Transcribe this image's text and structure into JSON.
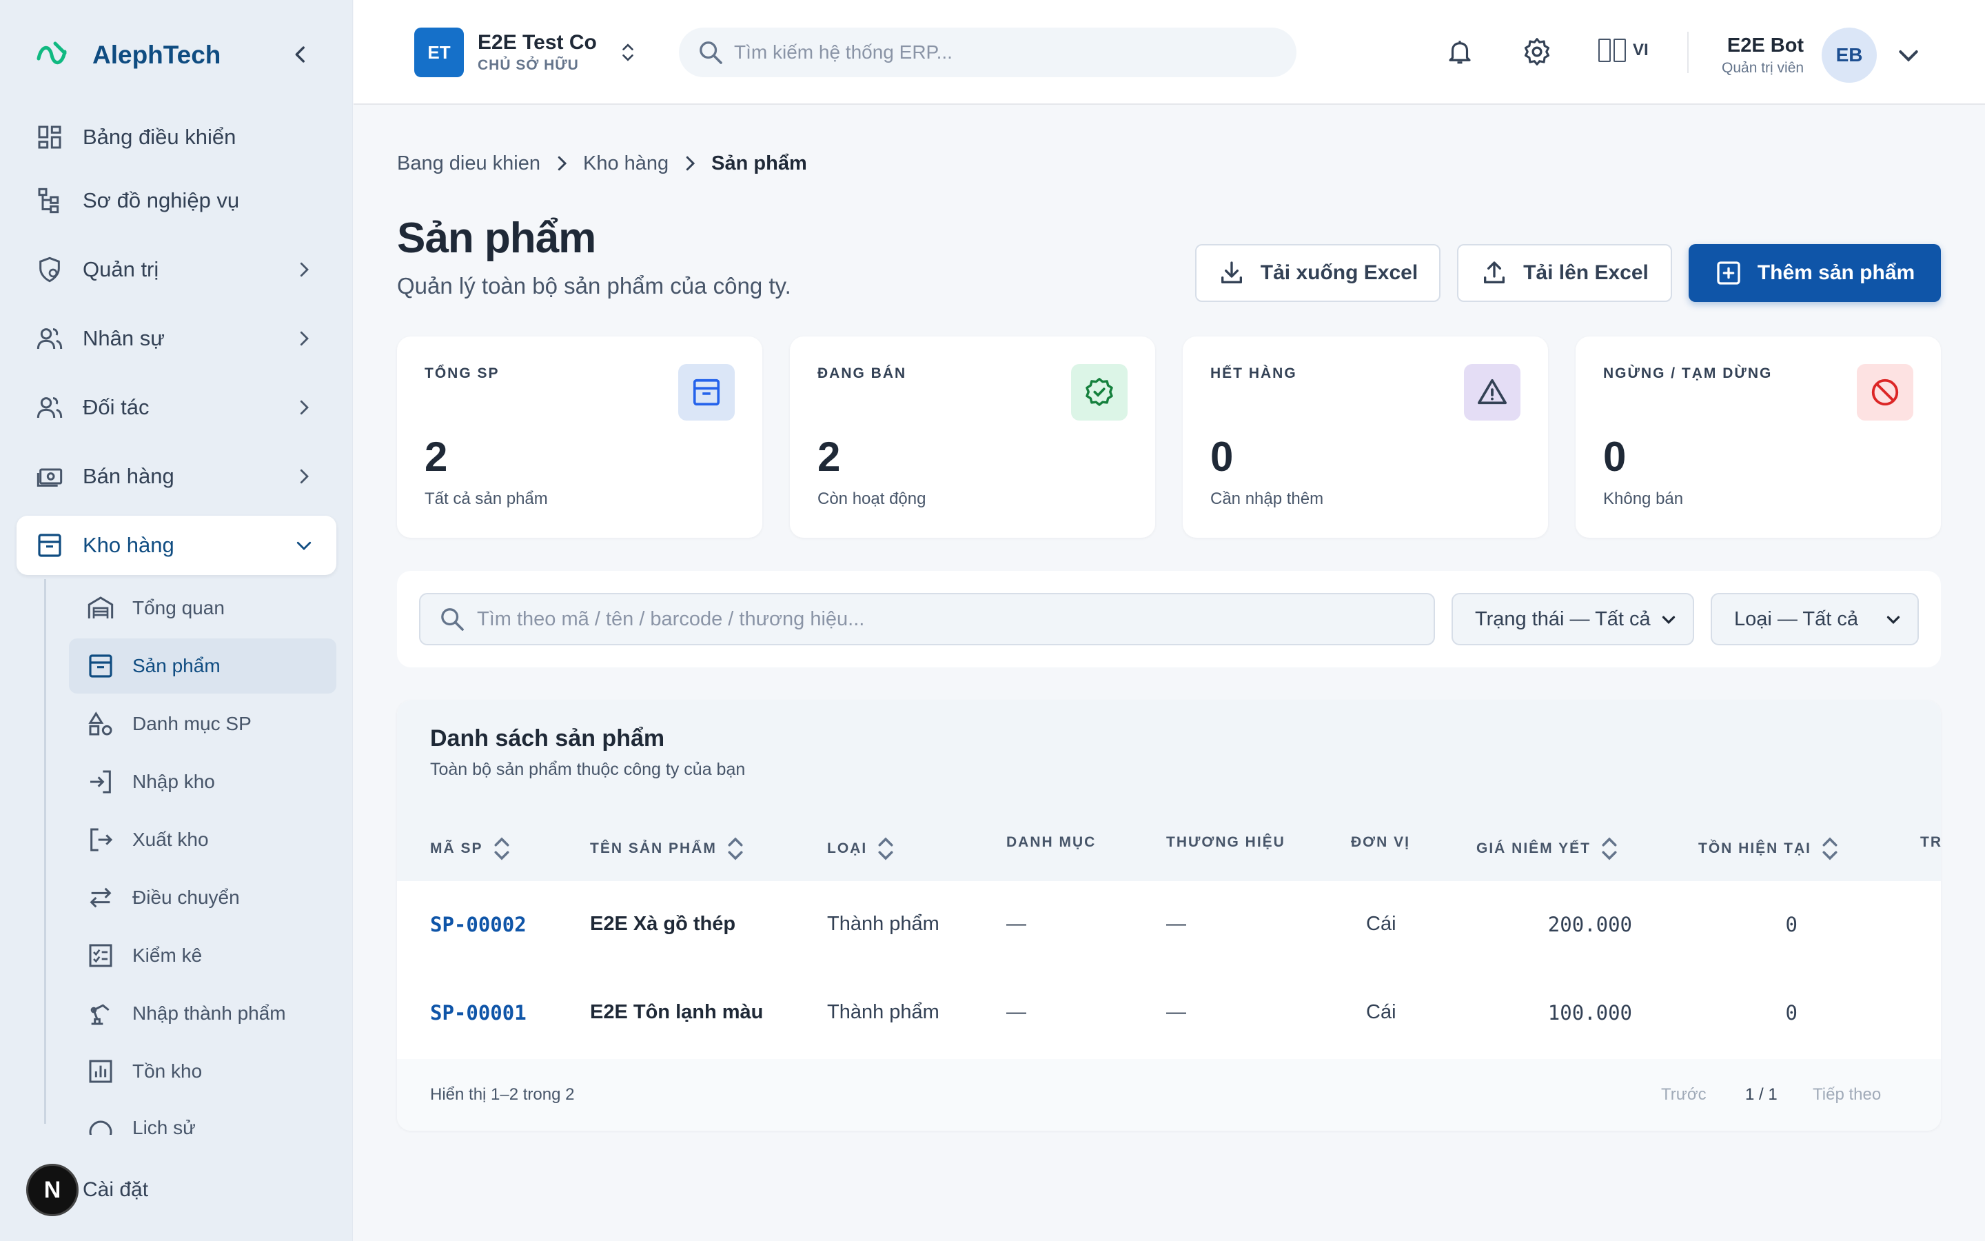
{
  "sidebar": {
    "brand": "AlephTech",
    "items": [
      {
        "label": "Bảng điều khiển",
        "icon": "dashboard-icon"
      },
      {
        "label": "Sơ đồ nghiệp vụ",
        "icon": "sitemap-icon"
      },
      {
        "label": "Quản trị",
        "icon": "admin-icon"
      },
      {
        "label": "Nhân sự",
        "icon": "users-icon"
      },
      {
        "label": "Đối tác",
        "icon": "partners-icon"
      },
      {
        "label": "Bán hàng",
        "icon": "cash-icon"
      },
      {
        "label": "Kho hàng",
        "icon": "archive-icon"
      }
    ],
    "sub_items": [
      {
        "label": "Tổng quan"
      },
      {
        "label": "Sản phẩm"
      },
      {
        "label": "Danh mục SP"
      },
      {
        "label": "Nhập kho"
      },
      {
        "label": "Xuất kho"
      },
      {
        "label": "Điều chuyển"
      },
      {
        "label": "Kiểm kê"
      },
      {
        "label": "Nhập thành phẩm"
      },
      {
        "label": "Tồn kho"
      },
      {
        "label": "Lịch sử"
      }
    ],
    "settings_badge": "N",
    "settings_label": "Cài đặt"
  },
  "topbar": {
    "company_avatar": "ET",
    "company_name": "E2E Test Co",
    "company_role": "CHỦ SỞ HỮU",
    "search_placeholder": "Tìm kiếm hệ thống ERP...",
    "language": "VI",
    "user_name": "E2E Bot",
    "user_role": "Quản trị viên",
    "user_initials": "EB"
  },
  "breadcrumb": [
    "Bang dieu khien",
    "Kho hàng",
    "Sản phẩm"
  ],
  "page": {
    "title": "Sản phẩm",
    "subtitle": "Quản lý toàn bộ sản phẩm của công ty."
  },
  "actions": {
    "download": "Tải xuống Excel",
    "upload": "Tải lên Excel",
    "add": "Thêm sản phẩm"
  },
  "stats": [
    {
      "label": "TỔNG SP",
      "value": "2",
      "note": "Tất cả sản phẩm",
      "icon": "archive-icon",
      "bg": "#dbe6f7",
      "color": "#2563eb"
    },
    {
      "label": "ĐANG BÁN",
      "value": "2",
      "note": "Còn hoạt động",
      "icon": "badge-check-icon",
      "bg": "#dcf5e7",
      "color": "#15803d"
    },
    {
      "label": "HẾT HÀNG",
      "value": "0",
      "note": "Cần nhập thêm",
      "icon": "warning-icon",
      "bg": "#e4ddf5",
      "color": "#334155"
    },
    {
      "label": "NGỪNG / TẠM DỪNG",
      "value": "0",
      "note": "Không bán",
      "icon": "ban-icon",
      "bg": "#fde2e2",
      "color": "#dc2626"
    }
  ],
  "filters": {
    "search_placeholder": "Tìm theo mã / tên / barcode / thương hiệu...",
    "status": "Trạng thái — Tất cả",
    "type": "Loại — Tất cả"
  },
  "table": {
    "title": "Danh sách sản phẩm",
    "subtitle": "Toàn bộ sản phẩm thuộc công ty của bạn",
    "columns": [
      "MÃ SP",
      "TÊN SẢN PHẨM",
      "LOẠI",
      "DANH MỤC",
      "THƯƠNG HIỆU",
      "ĐƠN VỊ",
      "GIÁ NIÊM YẾT",
      "TỒN HIỆN TẠI",
      "TR"
    ],
    "rows": [
      {
        "code": "SP-00002",
        "name": "E2E Xà gồ thép",
        "type": "Thành phẩm",
        "category": "—",
        "brand": "—",
        "unit": "Cái",
        "price": "200.000",
        "stock": "0"
      },
      {
        "code": "SP-00001",
        "name": "E2E Tôn lạnh màu",
        "type": "Thành phẩm",
        "category": "—",
        "brand": "—",
        "unit": "Cái",
        "price": "100.000",
        "stock": "0"
      }
    ],
    "footer_info": "Hiển thị 1–2 trong 2",
    "prev": "Trước",
    "page": "1 / 1",
    "next": "Tiếp theo"
  }
}
